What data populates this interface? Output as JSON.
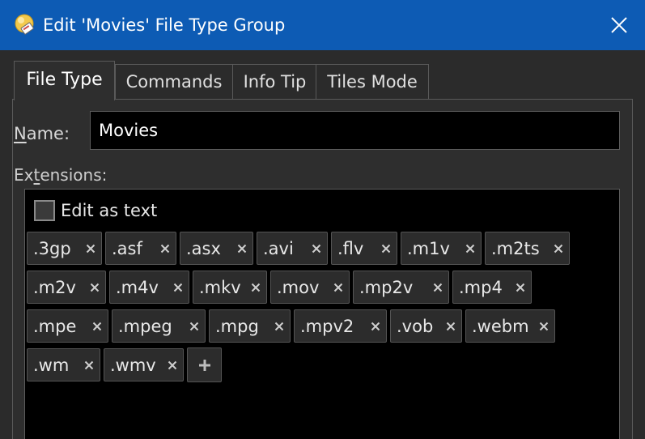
{
  "window": {
    "title": "Edit 'Movies' File Type Group",
    "accent": "#0d5bb4"
  },
  "tabs": [
    {
      "label": "File Type",
      "active": true
    },
    {
      "label": "Commands",
      "active": false
    },
    {
      "label": "Info Tip",
      "active": false
    },
    {
      "label": "Tiles Mode",
      "active": false
    }
  ],
  "name_field": {
    "label_mnemonic": "N",
    "label_rest": "ame:",
    "value": "Movies"
  },
  "extensions": {
    "label_pre": "Ex",
    "label_mnemonic": "t",
    "label_post": "ensions:",
    "edit_as_text": {
      "label": "Edit as text",
      "checked": false
    },
    "items": [
      ".3gp",
      ".asf",
      ".asx",
      ".avi",
      ".flv",
      ".m1v",
      ".m2ts",
      ".m2v",
      ".m4v",
      ".mkv",
      ".mov",
      ".mp2v",
      ".mp4",
      ".mpe",
      ".mpeg",
      ".mpg",
      ".mpv2",
      ".vob",
      ".webm",
      ".wm",
      ".wmv"
    ],
    "add_icon": "plus-icon",
    "remove_icon": "close-icon"
  }
}
